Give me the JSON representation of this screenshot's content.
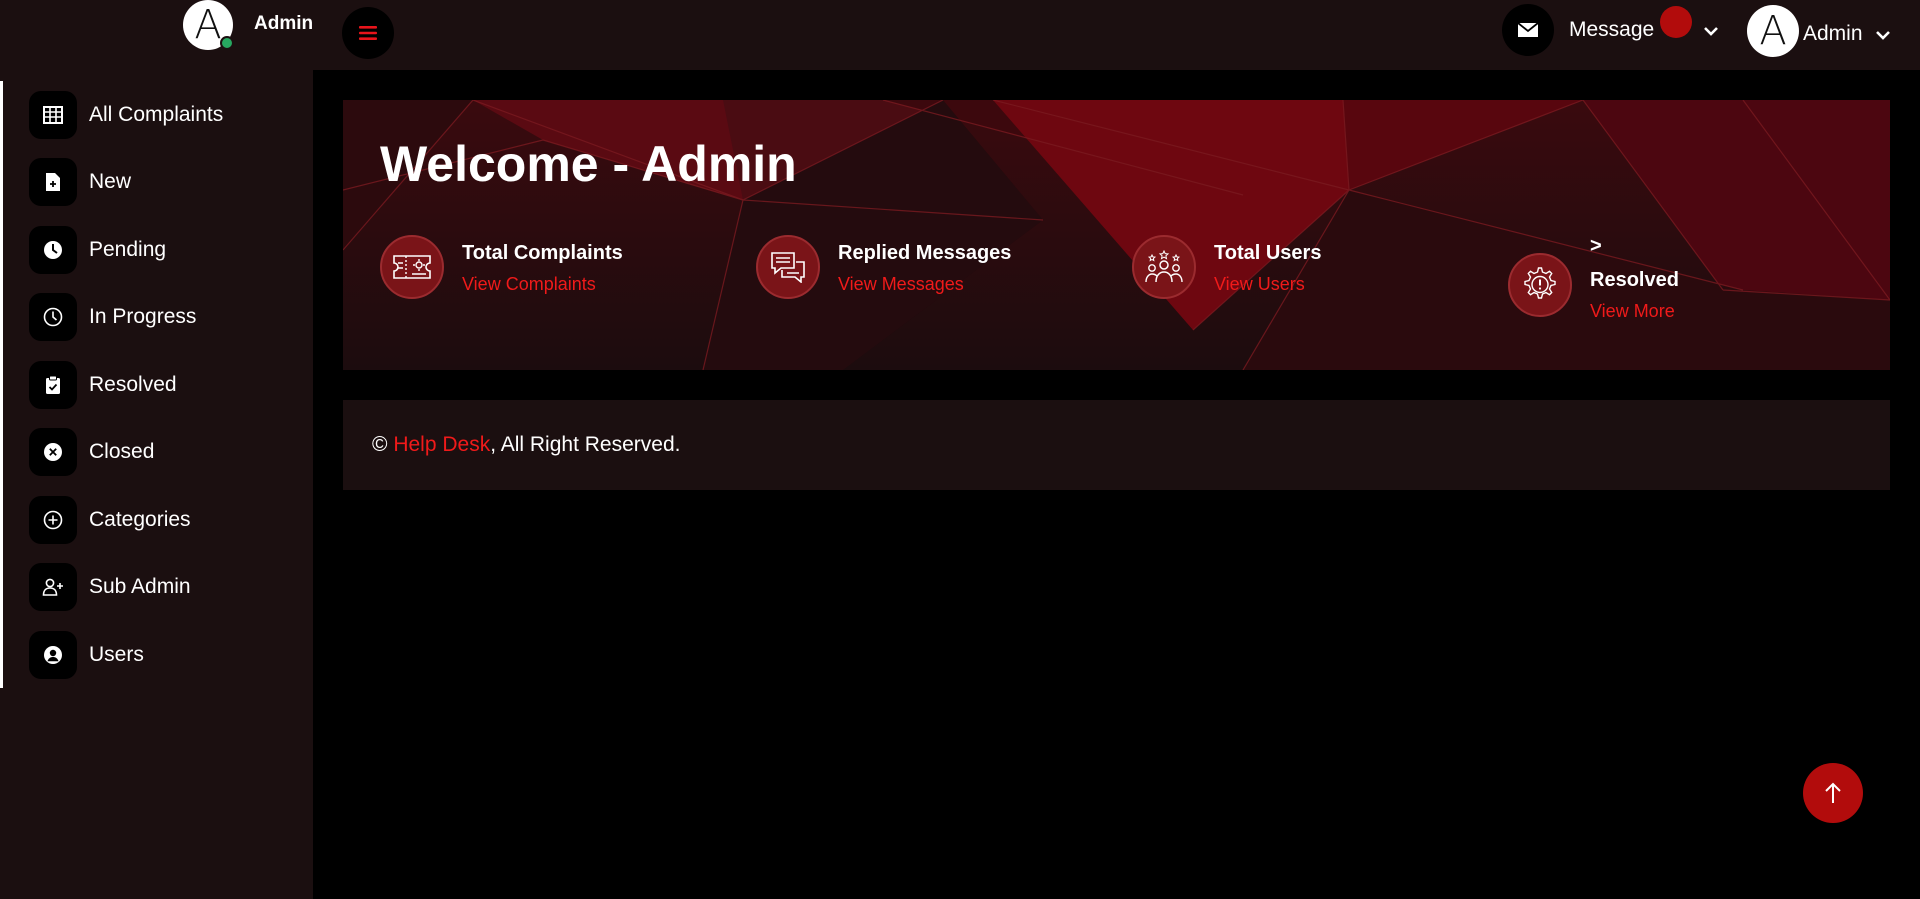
{
  "header": {
    "brand_avatar_letter": "A",
    "brand_name": "Admin",
    "menu_icon": "hamburger-icon",
    "message_label": "Message",
    "user_avatar_letter": "A",
    "user_name": "Admin"
  },
  "sidebar": {
    "items": [
      {
        "label": "All Complaints",
        "icon": "table-icon"
      },
      {
        "label": "New",
        "icon": "file-plus-icon"
      },
      {
        "label": "Pending",
        "icon": "clock-filled-icon"
      },
      {
        "label": "In Progress",
        "icon": "clock-outline-icon"
      },
      {
        "label": "Resolved",
        "icon": "clipboard-check-icon"
      },
      {
        "label": "Closed",
        "icon": "x-circle-icon"
      },
      {
        "label": "Categories",
        "icon": "plus-circle-icon"
      },
      {
        "label": "Sub Admin",
        "icon": "user-plus-icon"
      },
      {
        "label": "Users",
        "icon": "user-circle-icon"
      }
    ]
  },
  "hero": {
    "title": "Welcome - Admin",
    "stats": [
      {
        "title": "Total Complaints",
        "link": "View Complaints",
        "icon": "ticket-icon"
      },
      {
        "title": "Replied Messages",
        "link": "View Messages",
        "icon": "chat-icon"
      },
      {
        "title": "Total Users",
        "link": "View Users",
        "icon": "users-stars-icon"
      },
      {
        "prefix": ">",
        "title": "Resolved",
        "link": "View More",
        "icon": "gear-alert-icon"
      }
    ]
  },
  "footer": {
    "copyright_symbol": "©",
    "link_text": "Help Desk",
    "suffix": ", All Right Reserved."
  },
  "colors": {
    "accent": "#f01a1a",
    "accent_dark": "#b20c0c",
    "panel": "#1b0f10",
    "background": "#000000",
    "online_status": "#27a760"
  }
}
